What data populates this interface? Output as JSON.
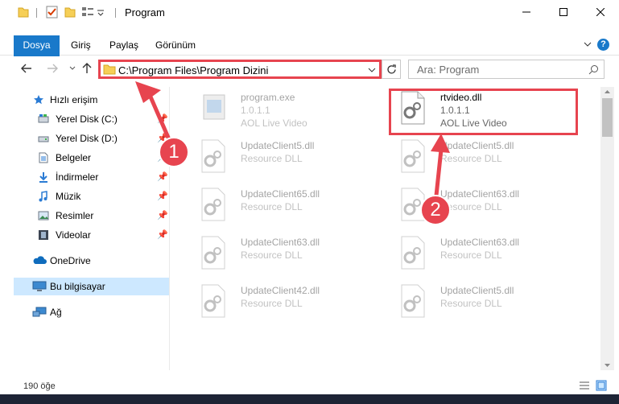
{
  "window": {
    "title": "Program"
  },
  "ribbon": {
    "tabs": [
      "Dosya",
      "Giriş",
      "Paylaş",
      "Görünüm"
    ],
    "help": "?"
  },
  "address": {
    "path": "C:\\Program Files\\Program Dizini",
    "search_placeholder": "Ara: Program"
  },
  "sidebar": {
    "items": [
      {
        "label": "Hızlı erişim",
        "icon": "star-icon"
      },
      {
        "label": "Yerel Disk (C:)",
        "icon": "drive-icon"
      },
      {
        "label": "Yerel Disk (D:)",
        "icon": "drive-icon"
      },
      {
        "label": "Belgeler",
        "icon": "documents-icon"
      },
      {
        "label": "İndirmeler",
        "icon": "download-icon"
      },
      {
        "label": "Müzik",
        "icon": "music-icon"
      },
      {
        "label": "Resimler",
        "icon": "pictures-icon"
      },
      {
        "label": "Videolar",
        "icon": "videos-icon"
      },
      {
        "label": "OneDrive",
        "icon": "cloud-icon"
      },
      {
        "label": "Bu bilgisayar",
        "icon": "computer-icon"
      },
      {
        "label": "Ağ",
        "icon": "network-icon"
      }
    ]
  },
  "files": [
    {
      "name": "program.exe",
      "line2": "1.0.1.1",
      "line3": "AOL Live Video"
    },
    {
      "name": "rtvideo.dll",
      "line2": "1.0.1.1",
      "line3": "AOL Live Video"
    },
    {
      "name": "UpdateClient5.dll",
      "line2": "Resource DLL"
    },
    {
      "name": "UpdateClient5.dll",
      "line2": "Resource DLL"
    },
    {
      "name": "UpdateClient65.dll",
      "line2": "Resource DLL"
    },
    {
      "name": "UpdateClient63.dll",
      "line2": "Resource DLL"
    },
    {
      "name": "UpdateClient63.dll",
      "line2": "Resource DLL"
    },
    {
      "name": "UpdateClient63.dll",
      "line2": "Resource DLL"
    },
    {
      "name": "UpdateClient42.dll",
      "line2": "Resource DLL"
    },
    {
      "name": "UpdateClient5.dll",
      "line2": "Resource DLL"
    }
  ],
  "status": {
    "count": "190 öğe"
  },
  "annotations": {
    "step1": "1",
    "step2": "2",
    "color": "#e7444f"
  }
}
